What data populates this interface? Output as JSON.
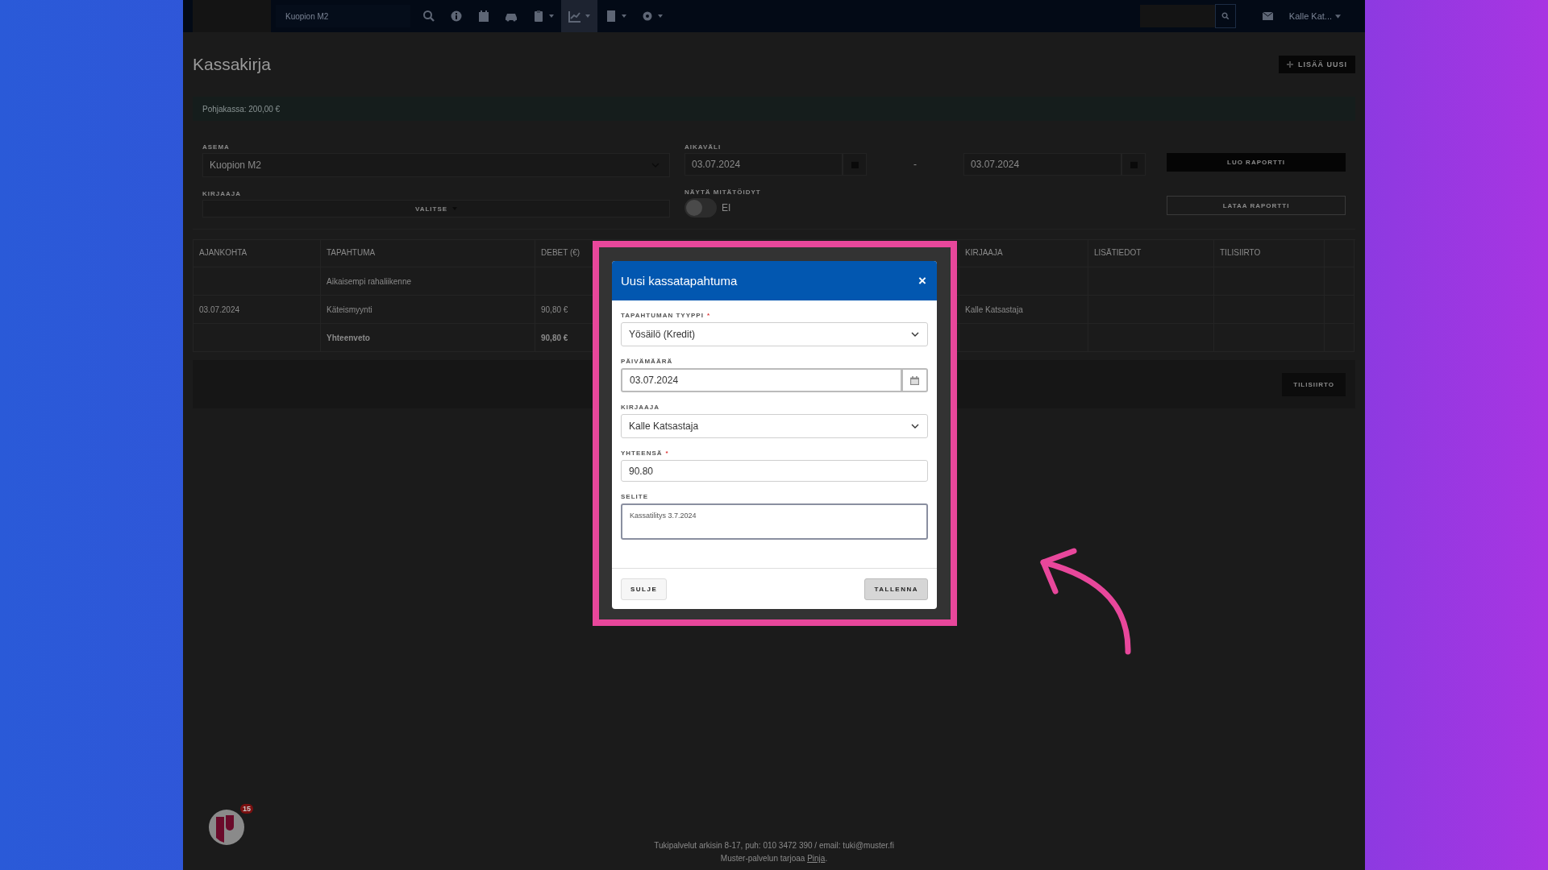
{
  "navbar": {
    "station": "Kuopion M2",
    "items": [
      {
        "kind": "search",
        "selected": false,
        "dropdown": false
      },
      {
        "kind": "info",
        "selected": false,
        "dropdown": false
      },
      {
        "kind": "calendar",
        "selected": false,
        "dropdown": false
      },
      {
        "kind": "car",
        "selected": false,
        "dropdown": false
      },
      {
        "kind": "clipboard",
        "selected": false,
        "dropdown": true
      },
      {
        "kind": "chart",
        "selected": true,
        "dropdown": true
      },
      {
        "kind": "document",
        "selected": false,
        "dropdown": true
      },
      {
        "kind": "settings",
        "selected": false,
        "dropdown": true
      }
    ],
    "user": "Kalle Kat..."
  },
  "page": {
    "title": "Kassakirja",
    "add_button": "LISÄÄ UUSI"
  },
  "banner": "Pohjakassa: 200,00 €",
  "filters": {
    "station_label": "ASEMA",
    "station": "Kuopion M2",
    "range_label": "AIKAVÄLI",
    "date_from": "03.07.2024",
    "range_separator": "-",
    "date_to": "03.07.2024",
    "create_report": "LUO RAPORTTI",
    "recorder_label": "KIRJAAJA",
    "recorder_select": "VALITSE",
    "show_void_label": "NÄYTÄ MITÄTÖIDYT",
    "show_void": {
      "on": false,
      "text": "EI"
    },
    "download_report": "LATAA RAPORTTI"
  },
  "table": {
    "columns": [
      {
        "label": "AJANKOHTA"
      },
      {
        "label": "TAPAHTUMA"
      },
      {
        "label": "DEBET (€)"
      },
      {
        "label": "KIRJAAJA"
      },
      {
        "label": "LISÄTIEDOT"
      },
      {
        "label": "TILISIIRTO"
      },
      {}
    ],
    "rows": [
      {
        "kind": "normal",
        "cells": {
          "event": "Aikaisempi rahaliikenne"
        }
      },
      {
        "kind": "normal",
        "cells": {
          "time": "03.07.2024",
          "event": "Käteismyynti",
          "debit": "90,80 €",
          "recorder": "Kalle Katsastaja"
        }
      },
      {
        "kind": "summary",
        "cells": {
          "event": "Yhteenveto",
          "debit": "90,80 €"
        }
      }
    ],
    "transfer_button": "TILISIIRTO"
  },
  "modal": {
    "title": "Uusi kassatapahtuma",
    "close": "×",
    "fields": [
      {
        "kind": "select",
        "label": "TAPAHTUMAN TYYPPI",
        "required_mark": "*",
        "value": "Yösäilö (Kredit)"
      },
      {
        "kind": "date",
        "label": "PÄIVÄMÄÄRÄ",
        "value": "03.07.2024"
      },
      {
        "kind": "select",
        "label": "KIRJAAJA",
        "value": "Kalle Katsastaja"
      },
      {
        "kind": "text",
        "label": "YHTEENSÄ",
        "required_mark": "*",
        "value": "90.80"
      },
      {
        "kind": "textarea",
        "label": "SELITE",
        "value": "Kassatilitys 3.7.2024"
      }
    ],
    "cancel": "SULJE",
    "save": "TALLENNA"
  },
  "chat": {
    "badge": "15"
  },
  "footer": {
    "support": "Tukipalvelut arkisin 8-17, puh: 010 3472 390 / email: tuki@muster.fi",
    "provider": "Muster-palvelun tarjoaa",
    "provider_link": "Pinja",
    "provider_end": "."
  }
}
